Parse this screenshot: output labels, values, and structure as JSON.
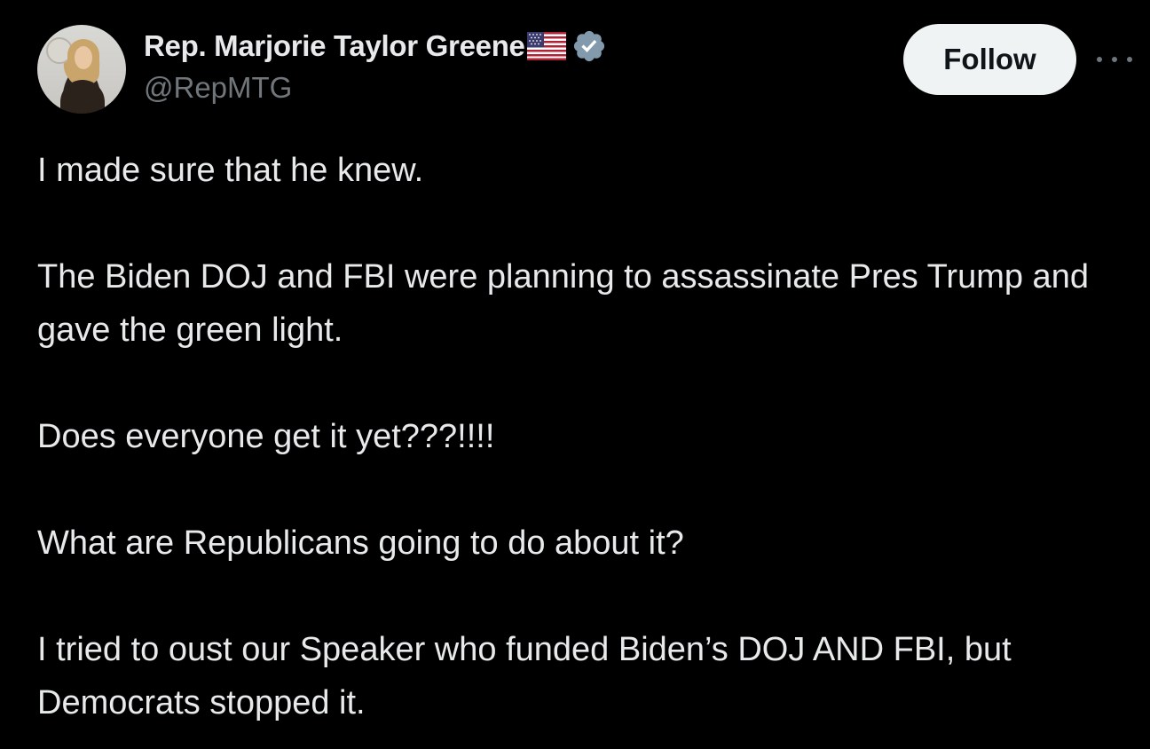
{
  "author": {
    "display_name": "Rep. Marjorie Taylor Greene",
    "handle": "@RepMTG",
    "flag_icon": "us-flag-icon",
    "verified_icon": "verified-badge-icon",
    "verified_color": "#829aab"
  },
  "actions": {
    "follow_label": "Follow",
    "more_icon": "more-options-icon"
  },
  "tweet": {
    "paragraphs": [
      "I made sure that he knew.",
      "The Biden DOJ and FBI were planning to assassinate Pres Trump and gave the green light.",
      "Does everyone get it yet???!!!!",
      "What are Republicans going to do about it?",
      "I tried to oust our Speaker who funded Biden’s DOJ AND FBI, but Democrats stopped it."
    ]
  },
  "colors": {
    "background": "#000000",
    "text_primary": "#e7e9ea",
    "text_secondary": "#71767b",
    "button_bg": "#eff3f4",
    "button_text": "#0f1419"
  }
}
